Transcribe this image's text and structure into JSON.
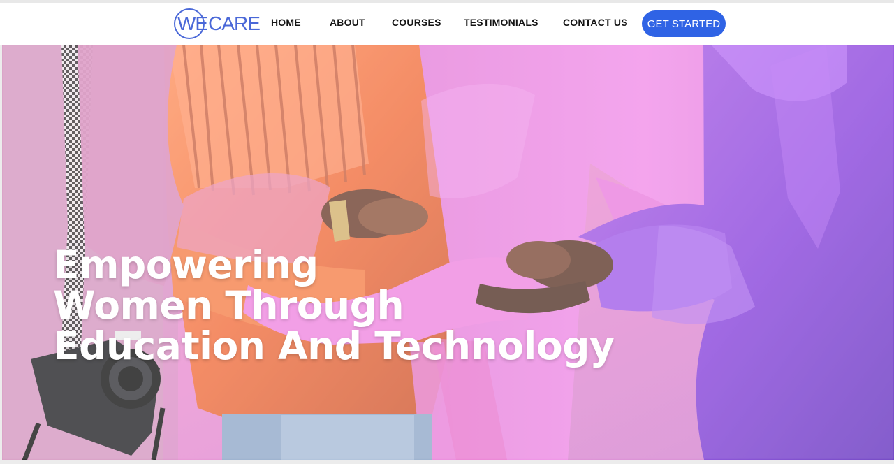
{
  "brand": {
    "logo_prefix": "WE",
    "logo_suffix": "CARE",
    "logo_color": "#4a68d8"
  },
  "nav": {
    "items": [
      {
        "label": "HOME"
      },
      {
        "label": "ABOUT"
      },
      {
        "label": "COURSES"
      },
      {
        "label": "TESTIMONIALS"
      },
      {
        "label": "CONTACT US"
      }
    ],
    "cta_label": "GET STARTED",
    "cta_color": "#2f63e5"
  },
  "hero": {
    "title_lines": [
      "Empowering",
      "Women Through",
      "Education And Technology"
    ],
    "image_subject": "four-people-arms-around-each-other-photo"
  }
}
